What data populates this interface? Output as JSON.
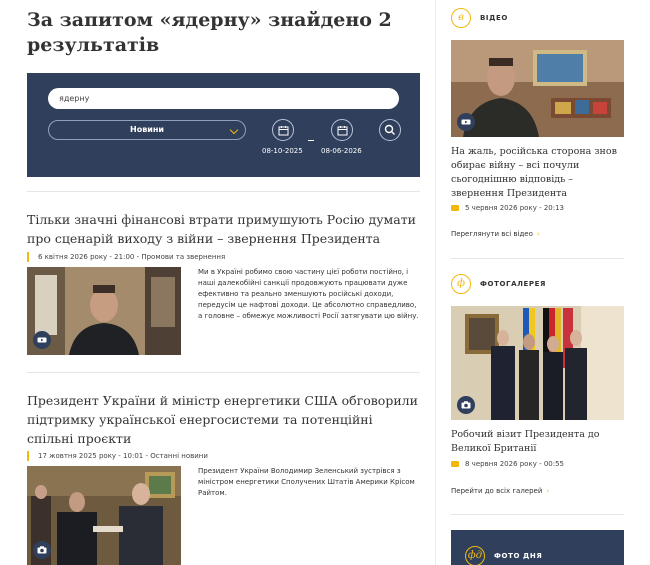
{
  "page_title": "За запитом «ядерну» знайдено 2 результатів",
  "search": {
    "query": "ядерну",
    "section": "Новини",
    "date_from": "08-10-2025",
    "date_to": "08-06-2026"
  },
  "articles": [
    {
      "title": "Тільки значні фінансові втрати примушують Росію думати про сценарій виходу з війни – звернення Президента",
      "meta": "6 квітня 2026 року - 21:00 - Промови та звернення",
      "text": "Ми в Україні робимо свою частину цієї роботи постійно, і наші далекобійні санкції продовжують працювати дуже ефективно та реально зменшують російські доходи, передусім це нафтові доходи. Це абсолютно справедливо, а головне – обмежує можливості Росії затягувати цю війну.",
      "media_icon": "video-icon"
    },
    {
      "title": "Президент України й міністр енергетики США обговорили підтримку української енергосистеми та потенційні спільні проєкти",
      "meta": "17 жовтня 2025 року - 10:01 - Останні новини",
      "text": "Президент України Володимир Зеленський зустрівся з міністром енергетики Сполучених Штатів Америки Крісом Райтом.",
      "media_icon": "camera-icon"
    }
  ],
  "sidebar": {
    "video": {
      "label": "ВІДЕО",
      "caption": "На жаль, російська сторона знов обирає війну – всі почули сьогоднішню відповідь – звернення Президента",
      "meta": "5 червня 2026 року - 20:13",
      "link": "Переглянути всі відео"
    },
    "gallery": {
      "label": "ФОТОГАЛЕРЕЯ",
      "caption": "Робочий візит Президента до Великої Британії",
      "meta": "8 червня 2026 року - 00:55",
      "link": "Перейти до всіх галерей"
    },
    "photo_day": {
      "label": "ФОТО ДНЯ"
    }
  },
  "colors": {
    "navy": "#2f3f5c",
    "accent": "#f2b90f"
  }
}
